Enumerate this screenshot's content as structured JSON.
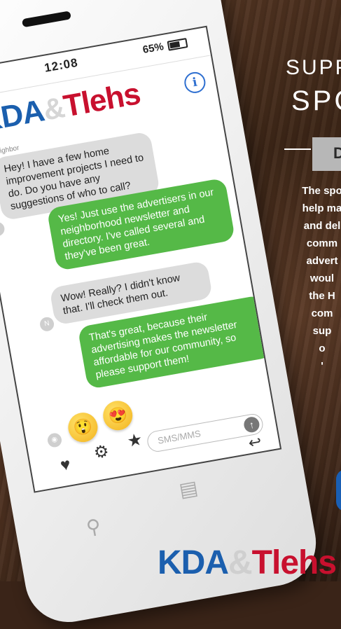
{
  "status": {
    "time": "12:08",
    "battery": "65%"
  },
  "brand": {
    "kda": "KDA",
    "amp": "&",
    "tlehs": "Tlehs"
  },
  "messages": [
    {
      "sender": "Neighbor",
      "text": "Hey! I have a few home improvement projects I need to do. Do you have any suggestions of who to call?",
      "dir": "in",
      "avatar": "N"
    },
    {
      "text": "Yes! Just use the advertisers in our neighborhood newsletter and directory. I've called several and they've been great.",
      "dir": "out"
    },
    {
      "text": "Wow! Really? I didn't know that. I'll check them out.",
      "dir": "in",
      "avatar": "N"
    },
    {
      "text": "That's great, because their advertising makes the newsletter affordable for our community, so please support them!",
      "dir": "out"
    }
  ],
  "compose": {
    "placeholder": "SMS/MMS"
  },
  "emojis": [
    "😲",
    "😍"
  ],
  "right_panel": {
    "line1": "SUPP",
    "line2": "SPC",
    "box": "D",
    "para": [
      "The spo",
      "help ma",
      "and del",
      "comm",
      "advert",
      "woul",
      "the H",
      "com",
      "sup",
      "o",
      "'"
    ]
  }
}
